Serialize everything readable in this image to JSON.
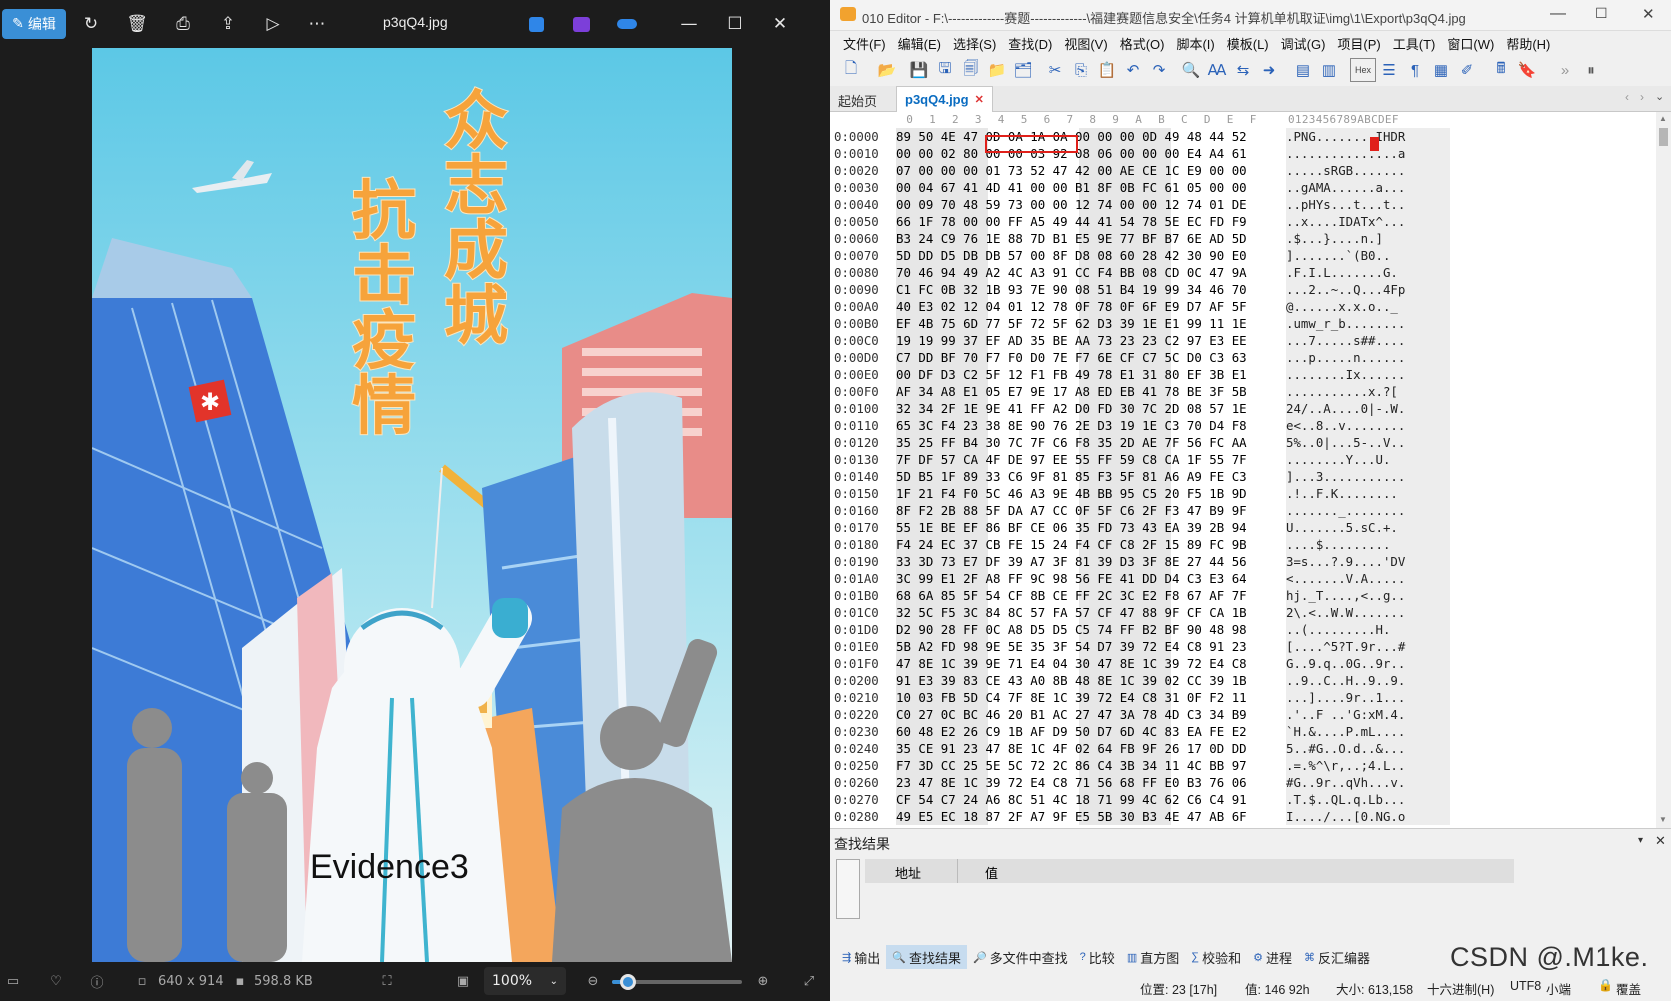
{
  "viewer": {
    "toolbar": {
      "edit_label": "编辑",
      "filename": "p3qQ4.jpg",
      "icons": [
        "rotate-icon",
        "delete-icon",
        "print-icon",
        "share-icon",
        "slideshow-icon",
        "more-icon",
        "designer-icon",
        "clipchamp-icon",
        "onedrive-icon",
        "minimize-icon",
        "maximize-icon",
        "close-icon"
      ]
    },
    "image": {
      "title_right": "众志成城",
      "title_left": "抗击疫情",
      "evidence_label": "Evidence3"
    },
    "status": {
      "dimensions": "640 x 914",
      "filesize": "598.8 KB",
      "zoom": "100%",
      "zoom_fraction": 0.12
    }
  },
  "editor": {
    "window_title": "010 Editor - F:\\-------------赛题-------------\\福建赛题信息安全\\任务4 计算机单机取证\\img\\1\\Export\\p3qQ4.jpg",
    "menu": [
      "文件(F)",
      "编辑(E)",
      "选择(S)",
      "查找(D)",
      "视图(V)",
      "格式(O)",
      "脚本(I)",
      "模板(L)",
      "调试(G)",
      "项目(P)",
      "工具(T)",
      "窗口(W)",
      "帮助(H)"
    ],
    "tabs": {
      "start": "起始页",
      "file": "p3qQ4.jpg"
    },
    "hex_header": [
      "0",
      "1",
      "2",
      "3",
      "4",
      "5",
      "6",
      "7",
      "8",
      "9",
      "A",
      "B",
      "C",
      "D",
      "E",
      "F"
    ],
    "ascii_header": "0123456789ABCDEF",
    "rows": [
      {
        "addr": "0:0000",
        "hex": "89 50 4E 47 0D 0A 1A 0A 00 00 00 0D 49 48 44 52",
        "ascii": ".PNG........IHDR"
      },
      {
        "addr": "0:0010",
        "hex": "00 00 02 80 00 00 03 92 08 06 00 00 00 E4 A4 61",
        "ascii": "...............a"
      },
      {
        "addr": "0:0020",
        "hex": "07 00 00 00 01 73 52 47 42 00 AE CE 1C E9 00 00",
        "ascii": ".....sRGB......."
      },
      {
        "addr": "0:0030",
        "hex": "00 04 67 41 4D 41 00 00 B1 8F 0B FC 61 05 00 00",
        "ascii": "..gAMA......a..."
      },
      {
        "addr": "0:0040",
        "hex": "00 09 70 48 59 73 00 00 12 74 00 00 12 74 01 DE",
        "ascii": "..pHYs...t...t.."
      },
      {
        "addr": "0:0050",
        "hex": "66 1F 78 00 00 FF A5 49 44 41 54 78 5E EC FD F9",
        "ascii": "..x....IDATx^..."
      },
      {
        "addr": "0:0060",
        "hex": "B3 24 C9 76 1E 88 7D B1 E5 9E 77 BF B7 6E AD 5D",
        "ascii": ".$...}....n.]"
      },
      {
        "addr": "0:0070",
        "hex": "5D DD D5 DB DB 57 00 8F D8 08 60 28 42 30 90 E0",
        "ascii": "].......`(B0.."
      },
      {
        "addr": "0:0080",
        "hex": "70 46 94 49 A2 4C A3 91 CC F4 BB 08 CD 0C 47 9A",
        "ascii": ".F.I.L.......G."
      },
      {
        "addr": "0:0090",
        "hex": "C1 FC 0B 32 1B 93 7E 90 08 51 B4 19 99 34 46 70",
        "ascii": "...2..~..Q...4Fp"
      },
      {
        "addr": "0:00A0",
        "hex": "40 E3 02 12 04 01 12 78 0F 78 0F 6F E9 D7 AF 5F",
        "ascii": "@......x.x.o.._"
      },
      {
        "addr": "0:00B0",
        "hex": "EF 4B 75 6D 77 5F 72 5F 62 D3 39 1E E1 99 11 1E",
        "ascii": ".umw_r_b........"
      },
      {
        "addr": "0:00C0",
        "hex": "19 19 99 37 EF AD 35 BE AA 73 23 23 C2 97 E3 EE",
        "ascii": "...7.....s##...."
      },
      {
        "addr": "0:00D0",
        "hex": "C7 DD BF 70 F7 F0 D0 7E F7 6E CF C7 5C D0 C3 63",
        "ascii": "...p.....n......"
      },
      {
        "addr": "0:00E0",
        "hex": "00 DF D3 C2 5F 12 F1 FB 49 78 E1 31 80 EF 3B E1",
        "ascii": "........Ix......"
      },
      {
        "addr": "0:00F0",
        "hex": "AF 34 A8 E1 05 E7 9E 17 A8 ED EB 41 78 BE 3F 5B",
        "ascii": "...........x.?["
      },
      {
        "addr": "0:0100",
        "hex": "32 34 2F 1E 9E 41 FF A2 D0 FD 30 7C 2D 08 57 1E",
        "ascii": "24/..A....0|-.W."
      },
      {
        "addr": "0:0110",
        "hex": "65 3C F4 23 38 8E 90 76 2E D3 19 1E C3 70 D4 F8",
        "ascii": "e<..8..v........"
      },
      {
        "addr": "0:0120",
        "hex": "35 25 FF B4 30 7C 7F C6 F8 35 2D AE 7F 56 FC AA",
        "ascii": "5%..0|...5-..V.."
      },
      {
        "addr": "0:0130",
        "hex": "7F DF 57 CA 4F DE 97 EE 55 FF 59 C8 CA 1F 55 7F",
        "ascii": "........Y...U."
      },
      {
        "addr": "0:0140",
        "hex": "5D B5 1F 89 33 C6 9F 81 85 F3 5F 81 A6 A9 FE C3",
        "ascii": "]...3..........."
      },
      {
        "addr": "0:0150",
        "hex": "1F 21 F4 F0 5C 46 A3 9E 4B BB 95 C5 20 F5 1B 9D",
        "ascii": ".!..F.K........"
      },
      {
        "addr": "0:0160",
        "hex": "8F F2 2B 88 5F DA A7 CC 0F 5F C6 2F F3 47 B9 9F",
        "ascii": "......._........"
      },
      {
        "addr": "0:0170",
        "hex": "55 1E BE EF 86 BF CE 06 35 FD 73 43 EA 39 2B 94",
        "ascii": "U.......5.sC.+."
      },
      {
        "addr": "0:0180",
        "hex": "F4 24 EC 37 CB FE 15 24 F4 CF C8 2F 15 89 FC 9B",
        "ascii": "....$........."
      },
      {
        "addr": "0:0190",
        "hex": "33 3D 73 E7 DF 39 A7 3F 81 39 D3 3F 8E 27 44 56",
        "ascii": "3=s...?.9....'DV"
      },
      {
        "addr": "0:01A0",
        "hex": "3C 99 E1 2F A8 FF 9C 98 56 FE 41 DD D4 C3 E3 64",
        "ascii": "<.......V.A....."
      },
      {
        "addr": "0:01B0",
        "hex": "68 6A 85 5F 54 CF 8B CE FF 2C 3C E2 F8 67 AF 7F",
        "ascii": "hj._T....,<..g.."
      },
      {
        "addr": "0:01C0",
        "hex": "32 5C F5 3C 84 8C 57 FA 57 CF 47 88 9F CF CA 1B",
        "ascii": "2\\.<..W.W......."
      },
      {
        "addr": "0:01D0",
        "hex": "D2 90 28 FF 0C A8 D5 D5 C5 74 FF B2 BF 90 48 98",
        "ascii": "..(.........H."
      },
      {
        "addr": "0:01E0",
        "hex": "5B A2 FD 98 9E 5E 35 3F 54 D7 39 72 E4 C8 91 23",
        "ascii": "[....^5?T.9r...#"
      },
      {
        "addr": "0:01F0",
        "hex": "47 8E 1C 39 9E 71 E4 04 30 47 8E 1C 39 72 E4 C8",
        "ascii": "G..9.q..0G..9r.."
      },
      {
        "addr": "0:0200",
        "hex": "91 E3 39 83 CE 43 A0 8B 48 8E 1C 39 02 CC 39 1B",
        "ascii": "..9..C..H..9..9."
      },
      {
        "addr": "0:0210",
        "hex": "10 03 FB 5D C4 7F 8E 1C 39 72 E4 C8 31 0F F2 11",
        "ascii": "...]....9r..1..."
      },
      {
        "addr": "0:0220",
        "hex": "C0 27 0C BC 46 20 B1 AC 27 47 3A 78 4D C3 34 B9",
        "ascii": ".'..F ..'G:xM.4."
      },
      {
        "addr": "0:0230",
        "hex": "60 48 E2 26 C9 1B AF D9 50 D7 6D 4C 83 EA FE E2",
        "ascii": "`H.&....P.mL...."
      },
      {
        "addr": "0:0240",
        "hex": "35 CE 91 23 47 8E 1C 4F 02 64 FB 9F 26 17 0D DD",
        "ascii": "5..#G..O.d..&..."
      },
      {
        "addr": "0:0250",
        "hex": "F7 3D CC 25 5E 5C 72 2C 86 C4 3B 34 11 4C BB 97",
        "ascii": ".=.%^\\r,..;4.L.."
      },
      {
        "addr": "0:0260",
        "hex": "23 47 8E 1C 39 72 E4 C8 71 56 68 FF E0 B3 76 06",
        "ascii": "#G..9r..qVh...v."
      },
      {
        "addr": "0:0270",
        "hex": "CF 54 C7 24 A6 8C 51 4C 18 71 99 4C 62 C6 C4 91",
        "ascii": ".T.$..QL.q.Lb..."
      },
      {
        "addr": "0:0280",
        "hex": "49 E5 EC 18 87 2F A7 9F E5 5B 30 B3 4E 47 AB 6F",
        "ascii": "I..../...[0.NG.o"
      }
    ],
    "find": {
      "title": "查找结果",
      "col_addr": "地址",
      "col_value": "值"
    },
    "bottom_tabs": [
      "输出",
      "查找结果",
      "多文件中查找",
      "比较",
      "直方图",
      "校验和",
      "进程",
      "反汇编器"
    ],
    "status": {
      "position": "位置: 23 [17h]",
      "value": "值: 146 92h",
      "size": "大小: 613,158",
      "mode": "十六进制(H)",
      "encoding": "UTF8",
      "endian": "小端",
      "overwrite": "覆盖"
    },
    "watermark": "CSDN @.M1ke."
  }
}
